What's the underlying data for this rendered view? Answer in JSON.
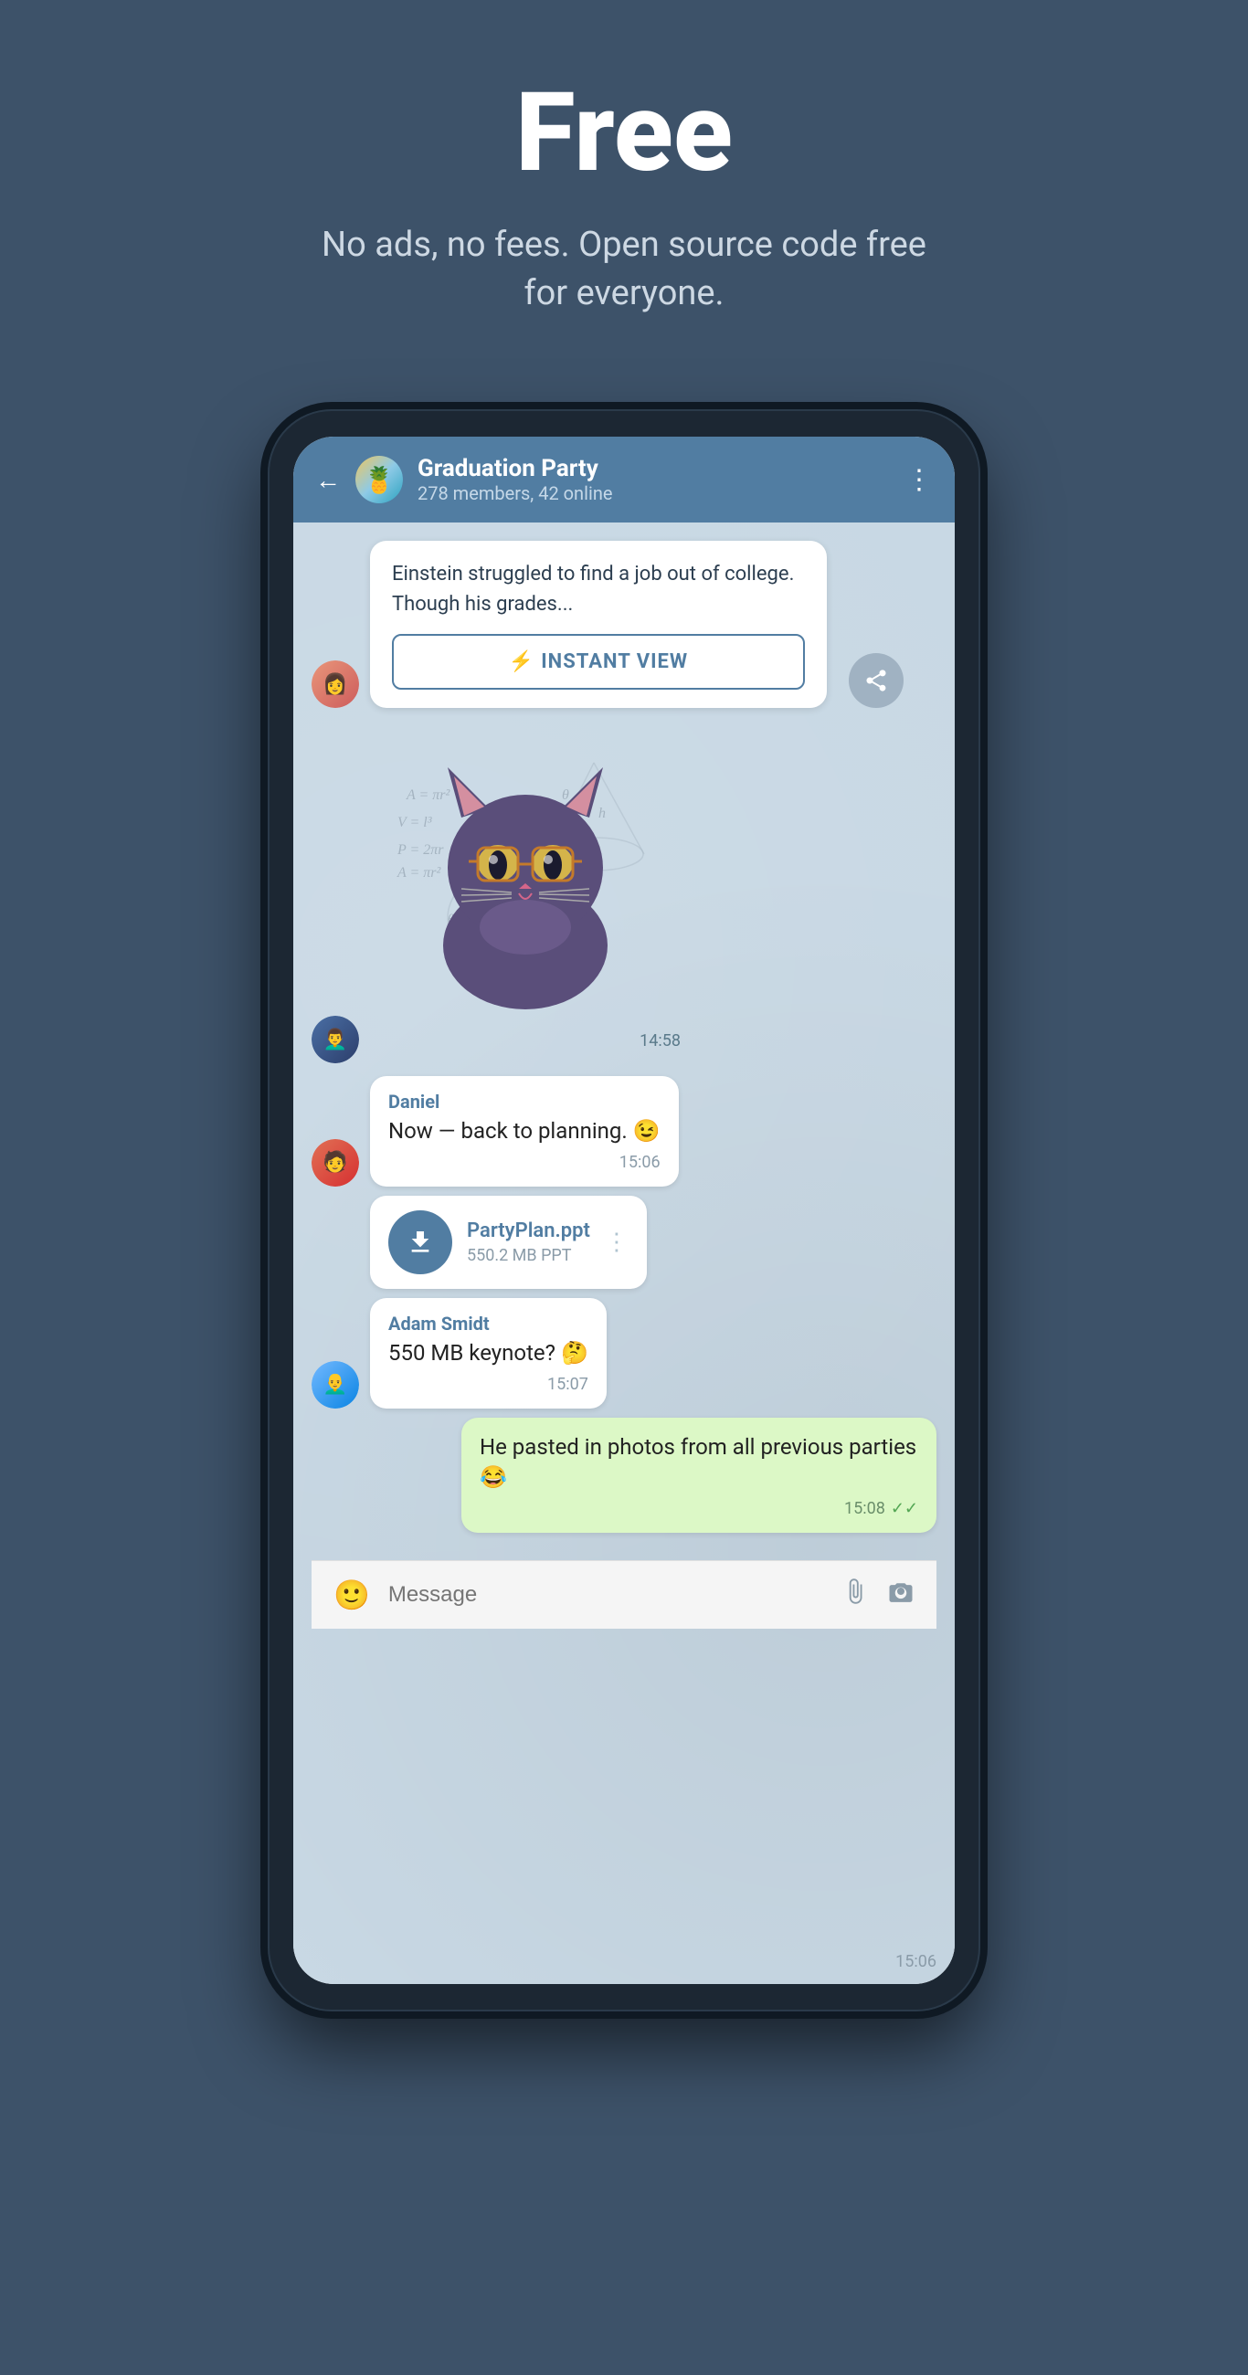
{
  "hero": {
    "title": "Free",
    "subtitle": "No ads, no fees. Open source code free for everyone."
  },
  "chat": {
    "back_label": "←",
    "group_name": "Graduation Party",
    "group_meta": "278 members, 42 online",
    "menu_icon": "⋮",
    "avatar_emoji": "🍍",
    "messages": [
      {
        "id": "iv-card",
        "type": "instant_view",
        "text": "Einstein struggled to find a job out of college. Though his grades...",
        "button_label": "INSTANT VIEW",
        "lightning": "⚡"
      },
      {
        "id": "sticker",
        "type": "sticker",
        "time": "14:58"
      },
      {
        "id": "daniel-msg",
        "type": "received",
        "sender": "Daniel",
        "text": "Now — back to planning. 😉",
        "time": "15:06"
      },
      {
        "id": "file-msg",
        "type": "file",
        "filename": "PartyPlan.ppt",
        "filesize": "550.2 MB PPT",
        "time": "15:06"
      },
      {
        "id": "adam-msg",
        "type": "received",
        "sender": "Adam Smidt",
        "text": "550 MB keynote? 🤔",
        "time": "15:07"
      },
      {
        "id": "own-msg",
        "type": "sent",
        "text": "He pasted in photos from all previous parties 😂",
        "time": "15:08",
        "read": true
      }
    ],
    "input_placeholder": "Message"
  }
}
